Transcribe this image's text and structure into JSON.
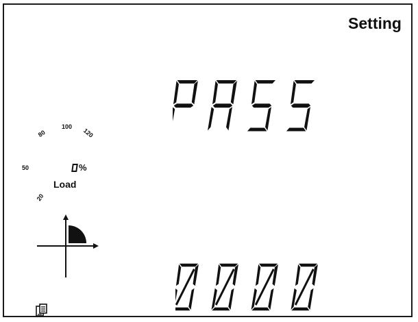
{
  "page": {
    "title": "Setting"
  },
  "display": {
    "main_text": "PASS",
    "value_text": "0000"
  },
  "load_gauge": {
    "scale_labels": [
      "20",
      "50",
      "80",
      "100",
      "120"
    ],
    "unit": "%",
    "label": "Load",
    "percent": 0
  },
  "icons": {
    "quadrant": "power-quadrant-icon",
    "communication": "communication-icon"
  },
  "colors": {
    "segment": "#111111",
    "background": "#ffffff"
  }
}
